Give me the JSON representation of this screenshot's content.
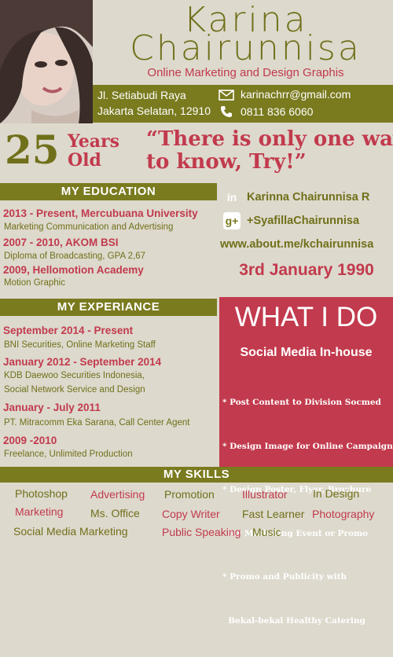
{
  "header": {
    "name_line1": "Karina",
    "name_line2": "Chairunnisa",
    "subtitle": "Online Marketing and Design Graphis"
  },
  "contact": {
    "address_line1": "Jl. Setiabudi Raya",
    "address_line2": "Jakarta Selatan, 12910",
    "email": "karinachrr@gmail.com",
    "phone": "0811 836 6060",
    "email_icon": "envelope-icon",
    "phone_icon": "phone-icon"
  },
  "age": {
    "number": "25",
    "unit_line1": "Years",
    "unit_line2": "Old"
  },
  "quote": {
    "line1": "“There is only one way",
    "line2": "to know, Try!”"
  },
  "education": {
    "heading": "MY EDUCATION",
    "items": [
      {
        "title": "2013 - Present, Mercubuana University",
        "detail": "Marketing Communication and Advertising"
      },
      {
        "title": "2007 - 2010, AKOM BSI",
        "detail": "Diploma of Broadcasting, GPA 2,67"
      },
      {
        "title": "2009, Hellomotion Academy",
        "detail": "Motion Graphic"
      }
    ]
  },
  "social": {
    "linkedin": "Karinna Chairunnisa R",
    "linkedin_icon": "linkedin-icon",
    "google": "+SyafillaChairunnisa",
    "google_icon": "google-plus-icon",
    "website": "www.about.me/kchairunnisa"
  },
  "dob": "3rd January 1990",
  "experience": {
    "heading": "MY EXPERIANCE",
    "items": [
      {
        "period": "September 2014 - Present",
        "details": [
          "BNI Securities, Online Marketing Staff"
        ]
      },
      {
        "period": "January 2012 - September 2014",
        "details": [
          "KDB Daewoo Securities Indonesia,",
          "Social Network Service and Design"
        ]
      },
      {
        "period": "January - July 2011",
        "details": [
          "PT. Mitracomm Eka Sarana, Call Center Agent"
        ]
      },
      {
        "period": "2009 -2010",
        "details": [
          "Freelance, Unlimited Production"
        ]
      }
    ]
  },
  "whatido": {
    "heading": "WHAT I DO",
    "title": "Social Media In-house",
    "items": [
      "* Post Content to Division Socmed",
      "* Design Image for Online Campaign",
      "* Design Poster, Flyer, Brochure",
      "  for Marketing Event or Promo",
      "* Promo and Publicity with",
      "  Bekal-bekal Healthy Catering"
    ]
  },
  "skills": {
    "heading": "MY SKILLS",
    "row1": [
      "Photoshop",
      "Advertising",
      "Promotion",
      "Illustrator",
      "In Design"
    ],
    "row2": [
      "Marketing",
      "Ms. Office",
      "Copy Writer",
      "Fast Learner",
      "Photography"
    ],
    "row3": [
      "Social Media Marketing",
      "Public Speaking",
      "Music"
    ]
  },
  "colors": {
    "olive": "#7a7a1f",
    "red": "#c23a4d",
    "background": "#ddd9cd"
  }
}
